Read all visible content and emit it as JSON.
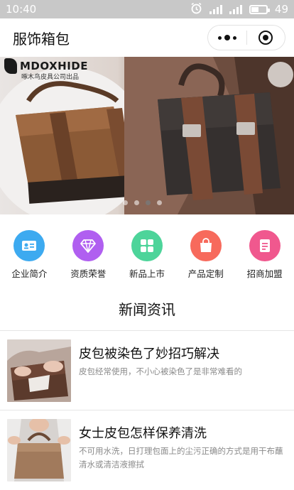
{
  "status_bar": {
    "time": "10:40",
    "battery": "49",
    "battery_level": 0.49
  },
  "header": {
    "title": "服饰箱包",
    "more_icon": "more-dots-icon",
    "close_icon": "target-circle-icon"
  },
  "banner": {
    "brand_name": "MDOXHIDE",
    "brand_sub": "啄木鸟皮具公司出品",
    "slides": 4,
    "active_slide": 3
  },
  "categories": [
    {
      "label": "企业简介",
      "icon": "id-card-icon",
      "color": "#3daaf0"
    },
    {
      "label": "资质荣誉",
      "icon": "diamond-icon",
      "color": "#b05ff0"
    },
    {
      "label": "新品上市",
      "icon": "grid-icon",
      "color": "#4dd49a"
    },
    {
      "label": "产品定制",
      "icon": "shopping-bag-icon",
      "color": "#f76a5c"
    },
    {
      "label": "招商加盟",
      "icon": "document-icon",
      "color": "#f0588e"
    }
  ],
  "news_section": {
    "title": "新闻资讯",
    "items": [
      {
        "title": "皮包被染色了妙招巧解决",
        "desc": "皮包经常使用，不小心被染色了是非常难看的"
      },
      {
        "title": "女士皮包怎样保养清洗",
        "desc": "不可用水洗，日打理包面上的尘污正确的方式是用干布蘸清水或清洁液擦拭"
      }
    ]
  }
}
